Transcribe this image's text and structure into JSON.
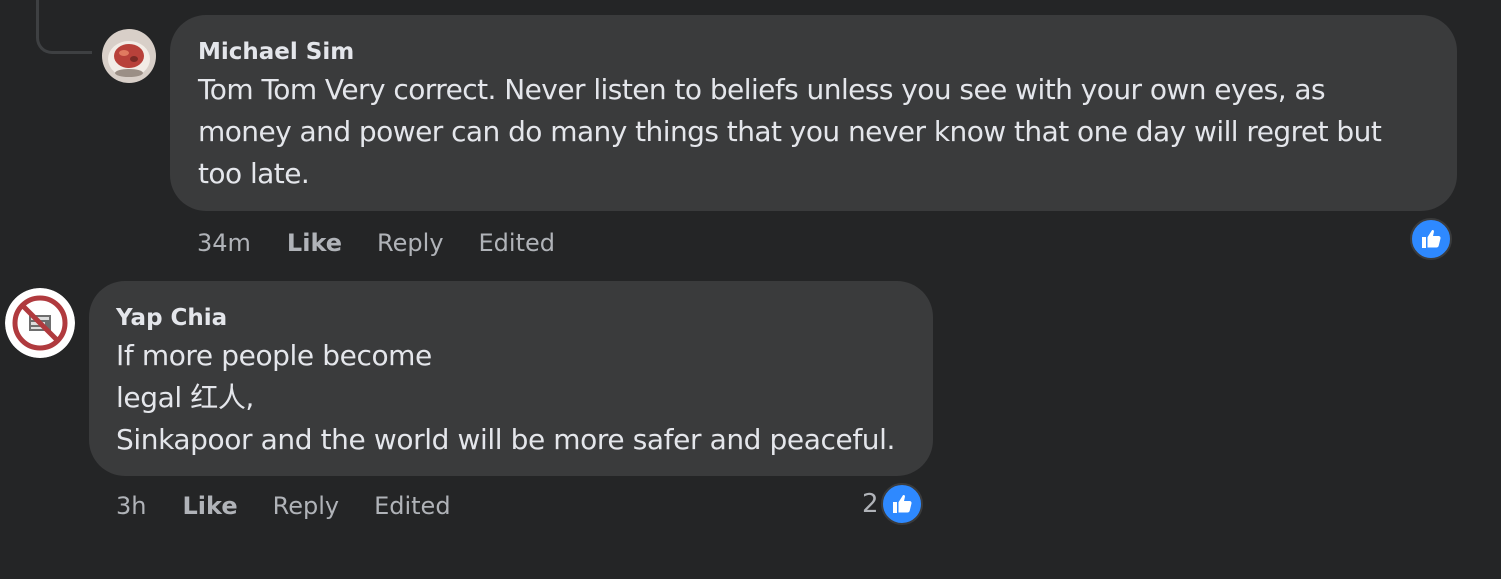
{
  "comments": [
    {
      "author": "Michael Sim",
      "lines": [
        "Tom Tom Very correct. Never listen to beliefs unless you see with your own eyes, as",
        "money and power can do many things that you never know that one day will regret but",
        "too late."
      ],
      "time": "34m",
      "like_label": "Like",
      "reply_label": "Reply",
      "edited_label": "Edited",
      "reaction_count": "",
      "avatar_icon": "food-bowl-avatar"
    },
    {
      "author": "Yap Chia",
      "lines": [
        "If more people become",
        "legal 红人,",
        "Sinkapoor and the world will be more safer and peaceful."
      ],
      "time": "3h",
      "like_label": "Like",
      "reply_label": "Reply",
      "edited_label": "Edited",
      "reaction_count": "2",
      "avatar_icon": "no-symbol-avatar"
    }
  ],
  "colors": {
    "background": "#242526",
    "bubble": "#3a3b3c",
    "text": "#e4e6eb",
    "secondary_text": "#b0b3b8",
    "like_blue": "#2e89ff"
  }
}
